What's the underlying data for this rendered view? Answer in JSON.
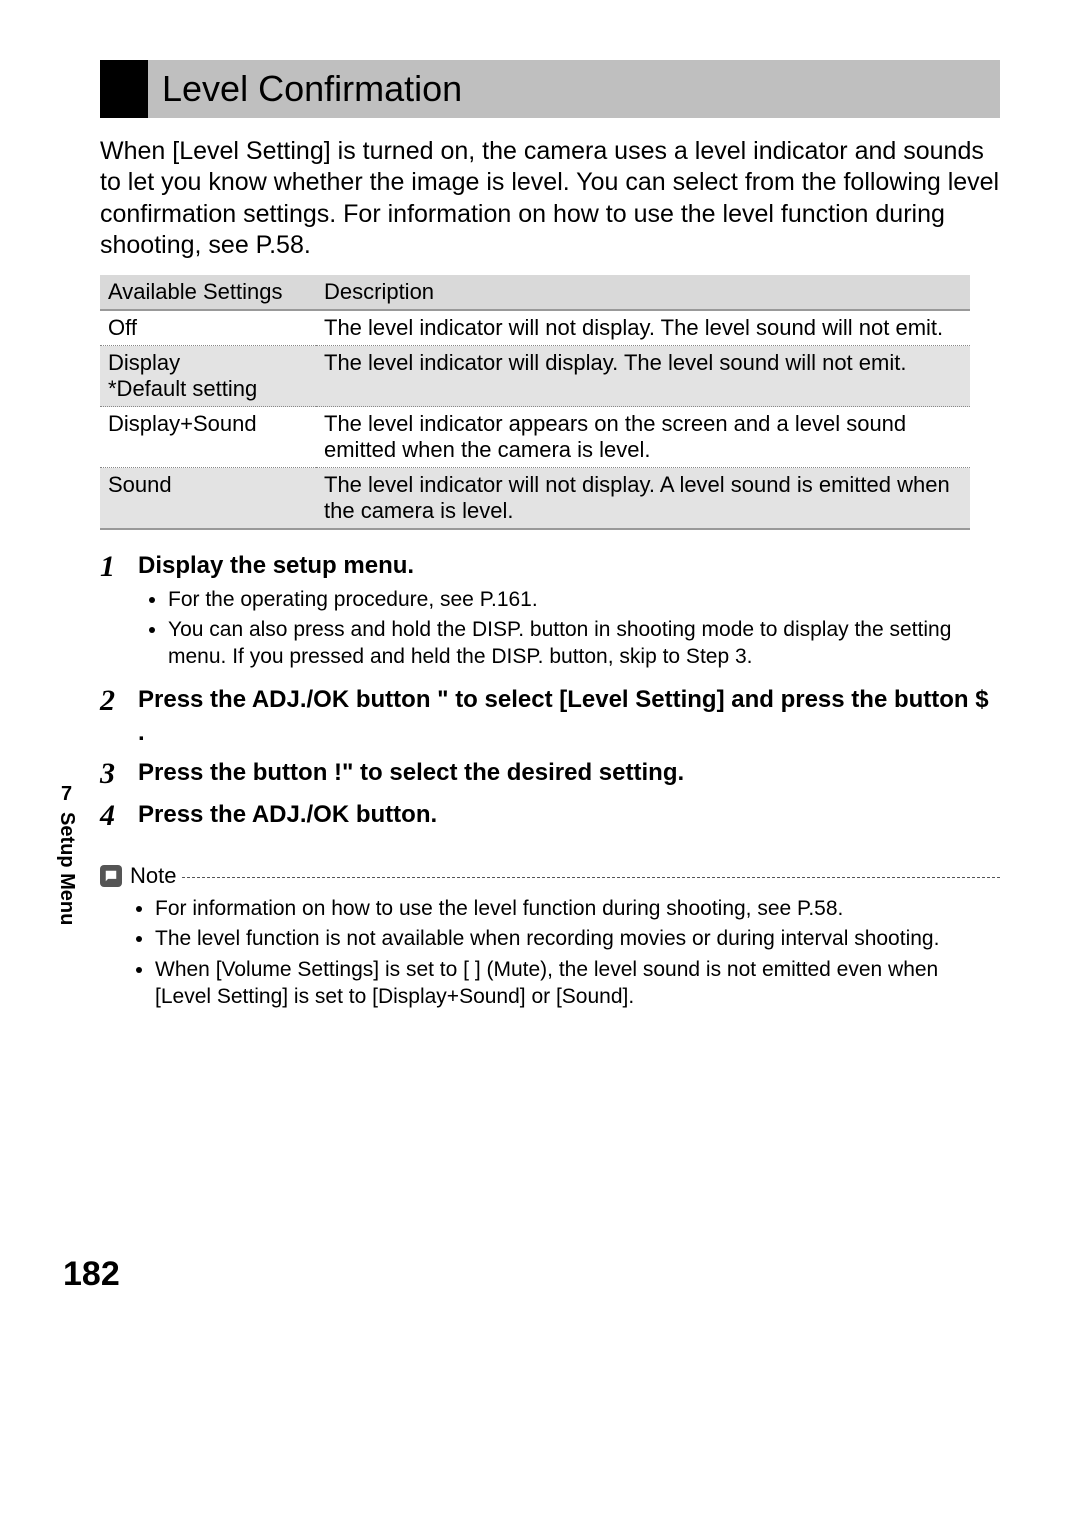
{
  "title": "Level Confirmation",
  "intro": "When [Level Setting] is turned on, the camera uses a level indicator and sounds to let you know whether the image is level. You can select from the following level confirmation settings. For information on how to use the level function during shooting, see P.58.",
  "table": {
    "headers": [
      "Available Settings",
      "Description"
    ],
    "rows": [
      {
        "setting": "Off",
        "desc": "The level indicator will not display. The level sound will not emit."
      },
      {
        "setting": "Display\n*Default setting",
        "desc": "The level indicator will display. The level sound will not emit."
      },
      {
        "setting": "Display+Sound",
        "desc": "The level indicator appears on the screen and a level sound emitted when the camera is level."
      },
      {
        "setting": "Sound",
        "desc": "The level indicator will not display. A level sound is emitted when the camera is level."
      }
    ]
  },
  "steps": [
    {
      "num": "1",
      "title": "Display the setup menu.",
      "bullets": [
        "For the operating procedure, see P.161.",
        "You can also press and hold the DISP. button in shooting mode to display the setting menu. If you pressed and held the DISP. button, skip to Step 3."
      ]
    },
    {
      "num": "2",
      "title": "Press the ADJ./OK button \"  to select [Level Setting] and press the button $ .",
      "bullets": []
    },
    {
      "num": "3",
      "title": "Press the button !\"    to select the desired setting.",
      "bullets": []
    },
    {
      "num": "4",
      "title": "Press the ADJ./OK button.",
      "bullets": []
    }
  ],
  "note_label": "Note",
  "note_bullets": [
    "For information on how to use the level function during shooting, see P.58.",
    "The level function is not available when recording movies or during interval shooting.",
    "When [Volume Settings] is set to [   ] (Mute), the level sound is not emitted even when [Level Setting] is set to [Display+Sound] or [Sound]."
  ],
  "side": {
    "chapter": "7",
    "label": "Setup Menu"
  },
  "page_number": "182"
}
